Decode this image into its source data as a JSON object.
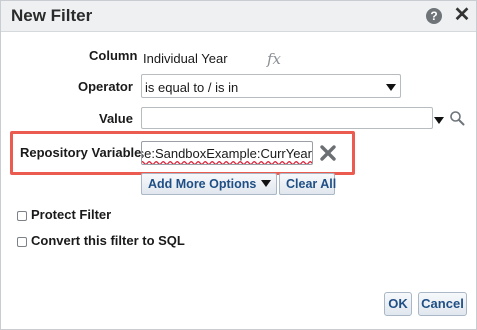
{
  "dialog": {
    "title": "New Filter",
    "help_icon_glyph": "?",
    "close_icon_glyph": "✕"
  },
  "form": {
    "column": {
      "label": "Column",
      "value": "Individual Year",
      "fx_glyph": "fx"
    },
    "operator": {
      "label": "Operator",
      "value": "is equal to / is in"
    },
    "value": {
      "label": "Value",
      "value": ""
    },
    "repository_variable": {
      "label": "Repository Variable",
      "value": "pase:SandboxExample:CurrYear"
    }
  },
  "buttons": {
    "add_more_options": "Add More Options",
    "clear_all": "Clear All",
    "ok": "OK",
    "cancel": "Cancel"
  },
  "options": {
    "protect_filter": {
      "label": "Protect Filter",
      "checked": false
    },
    "convert_to_sql": {
      "label": "Convert this filter to SQL",
      "checked": false
    }
  },
  "colors": {
    "highlight_border": "#ec5b4f",
    "button_text": "#1f4f85",
    "titlebar_bg": "#eef0f2"
  }
}
